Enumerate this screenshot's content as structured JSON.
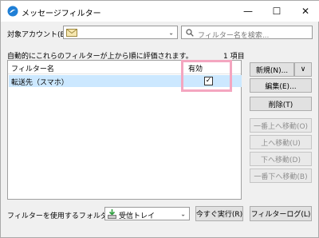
{
  "window": {
    "title": "メッセージフィルター",
    "minimize": "—",
    "maximize": "☐",
    "close": "✕"
  },
  "account": {
    "label": "対象アカウント(E):",
    "value": "",
    "search_placeholder": "フィルター名を検索..."
  },
  "list": {
    "caption": "自動的にこれらのフィルターが上から順に評価されます。",
    "count": "1 項目",
    "columns": {
      "name": "フィルター名",
      "enabled": "有効"
    },
    "rows": [
      {
        "name": "転送先（スマホ）",
        "enabled": "✓"
      }
    ]
  },
  "buttons": {
    "new": "新規(N)...",
    "new_arrow": "∨",
    "edit": "編集(E)...",
    "delete": "削除(T)",
    "move_top": "一番上へ移動(O)",
    "move_up": "上へ移動(U)",
    "move_down": "下へ移動(D)",
    "move_bottom": "一番下へ移動(B)"
  },
  "bottom": {
    "folder_label": "フィルターを使用するフォルダー(C):",
    "folder_value": "受信トレイ",
    "run_now": "今すぐ実行(R)",
    "filter_log": "フィルターログ(L)"
  },
  "colors": {
    "selection": "#cce8ff",
    "highlight_box": "#f4a6c0",
    "app_icon": "#1f7fd6",
    "inbox_icon": "#2e9e3e"
  }
}
